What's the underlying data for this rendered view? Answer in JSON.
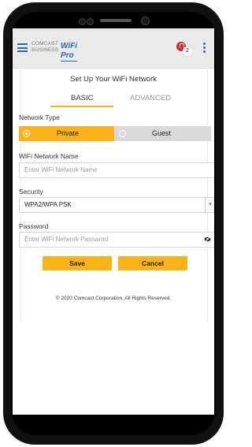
{
  "header": {
    "brand_top": "COMCAST",
    "brand_bottom": "BUSINESS",
    "brand_product": "WiFi Pro",
    "notification_count": "2"
  },
  "page": {
    "title": "Set Up Your WiFi Network",
    "tabs": [
      {
        "label": "BASIC",
        "active": true
      },
      {
        "label": "ADVANCED",
        "active": false
      }
    ]
  },
  "form": {
    "network_type_label": "Network Type",
    "network_type_options": [
      {
        "label": "Private",
        "selected": true
      },
      {
        "label": "Guest",
        "selected": false
      }
    ],
    "wifi_name_label": "WiFi Network Name",
    "wifi_name_placeholder": "Enter WiFi Network Name",
    "security_label": "Security",
    "security_value": "WPA2/WPA PSK",
    "password_label": "Password",
    "password_placeholder": "Enter WiFi Network Password"
  },
  "actions": {
    "save_label": "Save",
    "cancel_label": "Cancel"
  },
  "footer": {
    "copyright": "© 2020 Comcast Corporation. All Rights Reserved."
  },
  "colors": {
    "accent": "#f9b217",
    "brand_blue": "#2a68b1",
    "alert_red": "#d7262a"
  },
  "icons": [
    "menu-icon",
    "notification-icon",
    "more-vertical-icon",
    "radio-icon",
    "chevron-down-icon",
    "eye-hidden-icon"
  ]
}
